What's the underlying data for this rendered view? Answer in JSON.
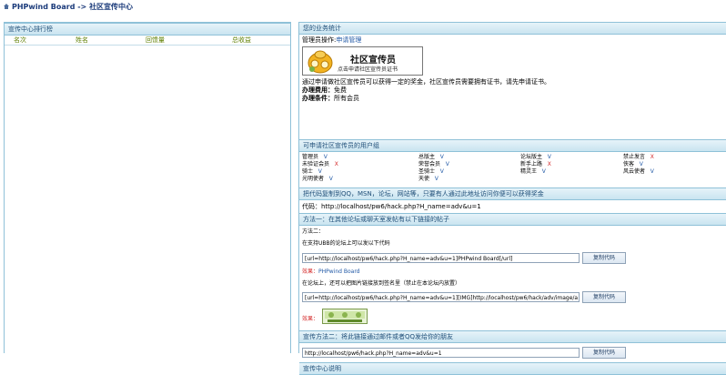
{
  "breadcrumb": {
    "site": "PHPwind Board",
    "sep": "->",
    "page": "社区宣传中心"
  },
  "left_panel": {
    "title": "宣传中心排行榜",
    "columns": [
      "名次",
      "姓名",
      "回馈量",
      "总收益"
    ]
  },
  "stats": {
    "title": "您的业务统计",
    "op_label": "管理员操作:",
    "op_link": "申请管理",
    "banner_title": "社区宣传员",
    "banner_sub": "点击申请社区宣传员证书",
    "desc": "通过申请做社区宣传员可以获得一定的奖金，社区宣传员需要拥有证书，请先申请证书。",
    "fee_label": "办理费用：",
    "fee_value": "免费",
    "cond_label": "办理条件：",
    "cond_value": "所有会员"
  },
  "groups": {
    "title": "可申请社区宣传员的用户组",
    "items": [
      {
        "name": "管理员",
        "ok": true,
        "mark": "V"
      },
      {
        "name": "总版主",
        "ok": true,
        "mark": "V"
      },
      {
        "name": "论坛版主",
        "ok": true,
        "mark": "V"
      },
      {
        "name": "禁止发言",
        "ok": false,
        "mark": "X"
      },
      {
        "name": "未验证会员",
        "ok": false,
        "mark": "X"
      },
      {
        "name": "荣誉会员",
        "ok": true,
        "mark": "V"
      },
      {
        "name": "新手上路",
        "ok": false,
        "mark": "X"
      },
      {
        "name": "侠客",
        "ok": true,
        "mark": "V"
      },
      {
        "name": "骑士",
        "ok": true,
        "mark": "V"
      },
      {
        "name": "圣骑士",
        "ok": true,
        "mark": "V"
      },
      {
        "name": "精灵王",
        "ok": true,
        "mark": "V"
      },
      {
        "name": "风云使者",
        "ok": true,
        "mark": "V"
      },
      {
        "name": "光明使者",
        "ok": true,
        "mark": "V"
      },
      {
        "name": "天使",
        "ok": true,
        "mark": "V"
      }
    ]
  },
  "share": {
    "title": "把代码复制到QQ，MSN，论坛，网站等，只要有人通过此地址访问你便可以获得奖金",
    "code_label": "代码：",
    "code_value": "http://localhost/pw6/hack.php?H_name=adv&u=1"
  },
  "method1": {
    "title": "方法一：在其他论坛或聊天室发帖有以下链接的帖子",
    "sub": "方法二：",
    "ubb_label": "在支持UBB的论坛上可以发以下代码",
    "ubb_code": "[url=http://localhost/pw6/hack.php?H_name=adv&u=1]PHPwind Board[/url]",
    "copy_label": "复制代码",
    "effect_label": "效果：",
    "effect_link": "PHPwind Board",
    "img_label": "在论坛上，还可以把图片链接放到签名里（禁止在本论坛内放置）",
    "img_code": "[url=http://localhost/pw6/hack.php?H_name=adv&u=1][IMG]http://localhost/pw6/hack/adv/image/a",
    "copy_label2": "复制代码",
    "effect_label2": "效果："
  },
  "method2": {
    "title": "宣传方法二：将此链接通过邮件或者QQ发给你的朋友",
    "link": "http://localhost/pw6/hack.php?H_name=adv&u=1",
    "copy_label": "复制代码"
  },
  "footer_section": {
    "title": "宣传中心说明"
  },
  "colors": {
    "header_bg": "#c9e4f0",
    "link": "#1f57a5",
    "red": "#d42a2a",
    "border": "#8fc1d8"
  }
}
